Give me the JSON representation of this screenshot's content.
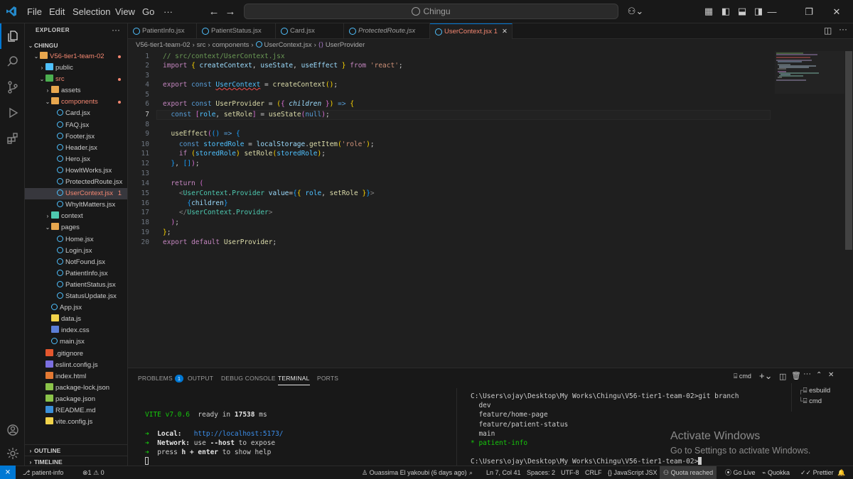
{
  "titlebar": {
    "menu": [
      "File",
      "Edit",
      "Selection",
      "View",
      "Go",
      "···"
    ],
    "search": "Chingu"
  },
  "sidebar": {
    "title": "EXPLORER",
    "more": "···",
    "root": "CHINGU",
    "project": "V56-tier1-team-02",
    "tree": [
      {
        "label": "public",
        "kind": "folder",
        "depth": 1,
        "open": false,
        "color": "#4fc1ff"
      },
      {
        "label": "src",
        "kind": "folder",
        "depth": 1,
        "open": true,
        "color": "#4caf50",
        "red": true
      },
      {
        "label": "assets",
        "kind": "folder",
        "depth": 2,
        "open": false,
        "color": "#e8a74e"
      },
      {
        "label": "components",
        "kind": "folder",
        "depth": 2,
        "open": true,
        "color": "#e8a74e",
        "red": true
      },
      {
        "label": "Card.jsx",
        "kind": "react",
        "depth": 3
      },
      {
        "label": "FAQ.jsx",
        "kind": "react",
        "depth": 3
      },
      {
        "label": "Footer.jsx",
        "kind": "react",
        "depth": 3
      },
      {
        "label": "Header.jsx",
        "kind": "react",
        "depth": 3
      },
      {
        "label": "Hero.jsx",
        "kind": "react",
        "depth": 3
      },
      {
        "label": "HowItWorks.jsx",
        "kind": "react",
        "depth": 3
      },
      {
        "label": "ProtectedRoute.jsx",
        "kind": "react",
        "depth": 3
      },
      {
        "label": "UserContext.jsx",
        "kind": "react",
        "depth": 3,
        "red": true,
        "badge": "1",
        "selected": true
      },
      {
        "label": "WhyItMatters.jsx",
        "kind": "react",
        "depth": 3
      },
      {
        "label": "context",
        "kind": "folder",
        "depth": 2,
        "open": false,
        "color": "#4ec9b0"
      },
      {
        "label": "pages",
        "kind": "folder",
        "depth": 2,
        "open": true,
        "color": "#e8a74e"
      },
      {
        "label": "Home.jsx",
        "kind": "react",
        "depth": 3
      },
      {
        "label": "Login.jsx",
        "kind": "react",
        "depth": 3
      },
      {
        "label": "NotFound.jsx",
        "kind": "react",
        "depth": 3
      },
      {
        "label": "PatientInfo.jsx",
        "kind": "react",
        "depth": 3
      },
      {
        "label": "PatientStatus.jsx",
        "kind": "react",
        "depth": 3
      },
      {
        "label": "StatusUpdate.jsx",
        "kind": "react",
        "depth": 3
      },
      {
        "label": "App.jsx",
        "kind": "react",
        "depth": 2
      },
      {
        "label": "data.js",
        "kind": "js",
        "depth": 2
      },
      {
        "label": "index.css",
        "kind": "css",
        "depth": 2
      },
      {
        "label": "main.jsx",
        "kind": "react",
        "depth": 2
      },
      {
        "label": ".gitignore",
        "kind": "git",
        "depth": 1
      },
      {
        "label": "eslint.config.js",
        "kind": "eslint",
        "depth": 1
      },
      {
        "label": "index.html",
        "kind": "html",
        "depth": 1
      },
      {
        "label": "package-lock.json",
        "kind": "npm",
        "depth": 1
      },
      {
        "label": "package.json",
        "kind": "npm",
        "depth": 1
      },
      {
        "label": "README.md",
        "kind": "info",
        "depth": 1
      },
      {
        "label": "vite.config.js",
        "kind": "js",
        "depth": 1
      }
    ],
    "outline": "OUTLINE",
    "timeline": "TIMELINE"
  },
  "tabs": [
    {
      "label": "PatientInfo.jsx"
    },
    {
      "label": "PatientStatus.jsx"
    },
    {
      "label": "Card.jsx"
    },
    {
      "label": "ProtectedRoute.jsx"
    },
    {
      "label": "UserContext.jsx 1",
      "active": true
    }
  ],
  "breadcrumb": [
    "V56-tier1-team-02",
    "src",
    "components",
    "UserContext.jsx",
    "UserProvider"
  ],
  "panel": {
    "tabs": [
      "PROBLEMS",
      "OUTPUT",
      "DEBUG CONSOLE",
      "TERMINAL",
      "PORTS"
    ],
    "problems_count": "1",
    "shell": "cmd",
    "terminals": [
      "esbuild",
      "cmd"
    ],
    "vite": {
      "name": "VITE v7.0.6",
      "ready": "ready in",
      "ms": "17538",
      "ms_unit": "ms",
      "local_label": "Local:",
      "local_url": "http://localhost:5173/",
      "network_label": "Network:",
      "network_text": "use",
      "network_flag": "--host",
      "network_tail": "to expose",
      "help_a": "press",
      "help_b": "h + enter",
      "help_c": "to show help"
    },
    "git": {
      "prompt1": "C:\\Users\\ojay\\Desktop\\My Works\\Chingu\\V56-tier1-team-02>git branch",
      "branches": [
        "dev",
        "feature/home-page",
        "feature/patient-status",
        "main"
      ],
      "current": "* patient-info",
      "prompt2": "C:\\Users\\ojay\\Desktop\\My Works\\Chingu\\V56-tier1-team-02>"
    },
    "watermark_title": "Activate Windows",
    "watermark_sub": "Go to Settings to activate Windows."
  },
  "status": {
    "branch": "patient-info",
    "errors": "1",
    "warnings": "0",
    "blame": "Ouassima El yakoubi (6 days ago)",
    "cursor": "Ln 7, Col 41",
    "spaces": "Spaces: 2",
    "encoding": "UTF-8",
    "eol": "CRLF",
    "language": "JavaScript JSX",
    "quota": "Quota reached",
    "golive": "Go Live",
    "quokka": "Quokka",
    "prettier": "Prettier"
  }
}
